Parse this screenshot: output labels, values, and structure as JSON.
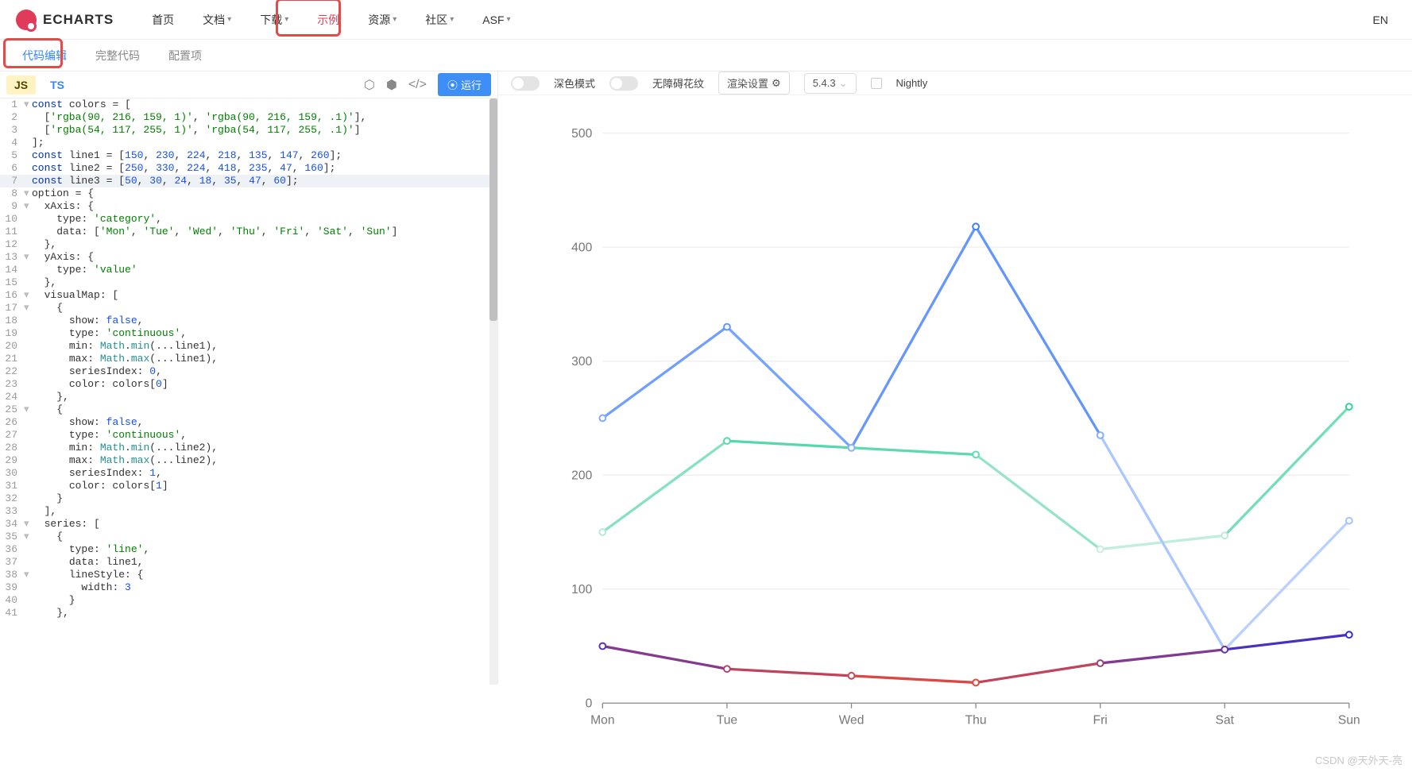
{
  "logo": {
    "text": "ECHARTS"
  },
  "nav": {
    "items": [
      {
        "label": "首页",
        "caret": false
      },
      {
        "label": "文档",
        "caret": true
      },
      {
        "label": "下载",
        "caret": true
      },
      {
        "label": "示例",
        "caret": false,
        "active": true
      },
      {
        "label": "资源",
        "caret": true
      },
      {
        "label": "社区",
        "caret": true
      },
      {
        "label": "ASF",
        "caret": true
      }
    ],
    "lang": "EN"
  },
  "subtabs": {
    "items": [
      {
        "label": "代码编辑",
        "active": true
      },
      {
        "label": "完整代码"
      },
      {
        "label": "配置项"
      }
    ]
  },
  "editor": {
    "lang_tabs": {
      "js": "JS",
      "ts": "TS"
    },
    "run": "运行",
    "code_lines": [
      {
        "n": 1,
        "fold": "▾",
        "html": "<span class='tok-kw'>const</span> <span class='tok-var'>colors</span> = ["
      },
      {
        "n": 2,
        "fold": "",
        "html": "  [<span class='tok-str'>'rgba(90, 216, 159, 1)'</span>, <span class='tok-str'>'rgba(90, 216, 159, .1)'</span>],"
      },
      {
        "n": 3,
        "fold": "",
        "html": "  [<span class='tok-str'>'rgba(54, 117, 255, 1)'</span>, <span class='tok-str'>'rgba(54, 117, 255, .1)'</span>]"
      },
      {
        "n": 4,
        "fold": "",
        "html": "];"
      },
      {
        "n": 5,
        "fold": "",
        "html": "<span class='tok-kw'>const</span> <span class='tok-var'>line1</span> = [<span class='tok-num'>150</span>, <span class='tok-num'>230</span>, <span class='tok-num'>224</span>, <span class='tok-num'>218</span>, <span class='tok-num'>135</span>, <span class='tok-num'>147</span>, <span class='tok-num'>260</span>];"
      },
      {
        "n": 6,
        "fold": "",
        "html": "<span class='tok-kw'>const</span> <span class='tok-var'>line2</span> = [<span class='tok-num'>250</span>, <span class='tok-num'>330</span>, <span class='tok-num'>224</span>, <span class='tok-num'>418</span>, <span class='tok-num'>235</span>, <span class='tok-num'>47</span>, <span class='tok-num'>160</span>];"
      },
      {
        "n": 7,
        "fold": "",
        "html": "<span class='tok-kw'>const</span> <span class='tok-var'>line3</span> = [<span class='tok-num'>50</span>, <span class='tok-num'>30</span>, <span class='tok-num'>24</span>, <span class='tok-num'>18</span>, <span class='tok-num'>35</span>, <span class='tok-num'>47</span>, <span class='tok-num'>60</span>];",
        "active": true
      },
      {
        "n": 8,
        "fold": "▾",
        "html": "<span class='tok-var'>option</span> = {"
      },
      {
        "n": 9,
        "fold": "▾",
        "html": "  <span class='tok-prop'>xAxis</span>: {"
      },
      {
        "n": 10,
        "fold": "",
        "html": "    <span class='tok-prop'>type</span>: <span class='tok-str'>'category'</span>,"
      },
      {
        "n": 11,
        "fold": "",
        "html": "    <span class='tok-prop'>data</span>: [<span class='tok-str'>'Mon'</span>, <span class='tok-str'>'Tue'</span>, <span class='tok-str'>'Wed'</span>, <span class='tok-str'>'Thu'</span>, <span class='tok-str'>'Fri'</span>, <span class='tok-str'>'Sat'</span>, <span class='tok-str'>'Sun'</span>]"
      },
      {
        "n": 12,
        "fold": "",
        "html": "  },"
      },
      {
        "n": 13,
        "fold": "▾",
        "html": "  <span class='tok-prop'>yAxis</span>: {"
      },
      {
        "n": 14,
        "fold": "",
        "html": "    <span class='tok-prop'>type</span>: <span class='tok-str'>'value'</span>"
      },
      {
        "n": 15,
        "fold": "",
        "html": "  },"
      },
      {
        "n": 16,
        "fold": "▾",
        "html": "  <span class='tok-prop'>visualMap</span>: ["
      },
      {
        "n": 17,
        "fold": "▾",
        "html": "    {"
      },
      {
        "n": 18,
        "fold": "",
        "html": "      <span class='tok-prop'>show</span>: <span class='tok-bool'>false</span>,"
      },
      {
        "n": 19,
        "fold": "",
        "html": "      <span class='tok-prop'>type</span>: <span class='tok-str'>'continuous'</span>,"
      },
      {
        "n": 20,
        "fold": "",
        "html": "      <span class='tok-prop'>min</span>: <span class='tok-id'>Math</span>.<span class='tok-id'>min</span>(...line1),"
      },
      {
        "n": 21,
        "fold": "",
        "html": "      <span class='tok-prop'>max</span>: <span class='tok-id'>Math</span>.<span class='tok-id'>max</span>(...line1),"
      },
      {
        "n": 22,
        "fold": "",
        "html": "      <span class='tok-prop'>seriesIndex</span>: <span class='tok-num'>0</span>,"
      },
      {
        "n": 23,
        "fold": "",
        "html": "      <span class='tok-prop'>color</span>: colors[<span class='tok-num'>0</span>]"
      },
      {
        "n": 24,
        "fold": "",
        "html": "    },"
      },
      {
        "n": 25,
        "fold": "▾",
        "html": "    {"
      },
      {
        "n": 26,
        "fold": "",
        "html": "      <span class='tok-prop'>show</span>: <span class='tok-bool'>false</span>,"
      },
      {
        "n": 27,
        "fold": "",
        "html": "      <span class='tok-prop'>type</span>: <span class='tok-str'>'continuous'</span>,"
      },
      {
        "n": 28,
        "fold": "",
        "html": "      <span class='tok-prop'>min</span>: <span class='tok-id'>Math</span>.<span class='tok-id'>min</span>(...line2),"
      },
      {
        "n": 29,
        "fold": "",
        "html": "      <span class='tok-prop'>max</span>: <span class='tok-id'>Math</span>.<span class='tok-id'>max</span>(...line2),"
      },
      {
        "n": 30,
        "fold": "",
        "html": "      <span class='tok-prop'>seriesIndex</span>: <span class='tok-num'>1</span>,"
      },
      {
        "n": 31,
        "fold": "",
        "html": "      <span class='tok-prop'>color</span>: colors[<span class='tok-num'>1</span>]"
      },
      {
        "n": 32,
        "fold": "",
        "html": "    }"
      },
      {
        "n": 33,
        "fold": "",
        "html": "  ],"
      },
      {
        "n": 34,
        "fold": "▾",
        "html": "  <span class='tok-prop'>series</span>: ["
      },
      {
        "n": 35,
        "fold": "▾",
        "html": "    {"
      },
      {
        "n": 36,
        "fold": "",
        "html": "      <span class='tok-prop'>type</span>: <span class='tok-str'>'line'</span>,"
      },
      {
        "n": 37,
        "fold": "",
        "html": "      <span class='tok-prop'>data</span>: line1,"
      },
      {
        "n": 38,
        "fold": "▾",
        "html": "      <span class='tok-prop'>lineStyle</span>: {"
      },
      {
        "n": 39,
        "fold": "",
        "html": "        <span class='tok-prop'>width</span>: <span class='tok-num'>3</span>"
      },
      {
        "n": 40,
        "fold": "",
        "html": "      }"
      },
      {
        "n": 41,
        "fold": "",
        "html": "    },"
      }
    ]
  },
  "right_toolbar": {
    "dark_mode": "深色模式",
    "aria": "无障碍花纹",
    "render": "渲染设置",
    "version": "5.4.3",
    "nightly": "Nightly"
  },
  "chart_data": {
    "type": "line",
    "categories": [
      "Mon",
      "Tue",
      "Wed",
      "Thu",
      "Fri",
      "Sat",
      "Sun"
    ],
    "series": [
      {
        "name": "line1",
        "values": [
          150,
          230,
          224,
          218,
          135,
          147,
          260
        ],
        "color_low": "#c8eedf",
        "color_high": "#2fd09a"
      },
      {
        "name": "line2",
        "values": [
          250,
          330,
          224,
          418,
          235,
          47,
          160
        ],
        "color_low": "#cfe0ff",
        "color_high": "#3f7dff"
      },
      {
        "name": "line3",
        "values": [
          50,
          30,
          24,
          18,
          35,
          47,
          60
        ],
        "color_low": "#e64a3a",
        "color_high": "#2e2bd8"
      }
    ],
    "ylim": [
      0,
      500
    ],
    "yticks": [
      0,
      100,
      200,
      300,
      400,
      500
    ]
  },
  "watermark": "CSDN @天外天-亮"
}
